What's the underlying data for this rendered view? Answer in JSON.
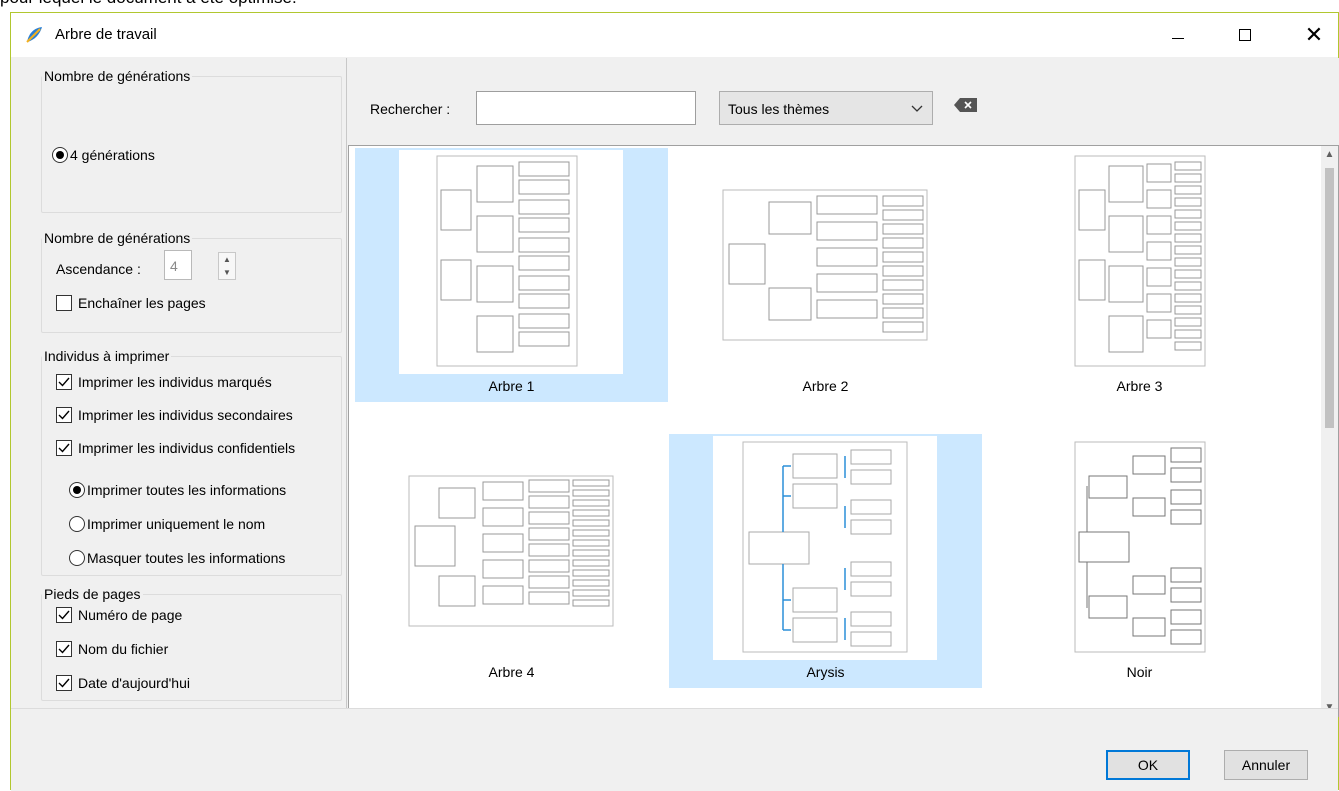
{
  "background_caption": "pour lequel le document a été optimisé.",
  "window": {
    "title": "Arbre de travail",
    "icon": "app-leaf-icon",
    "controls": [
      "minimize-icon",
      "maximize-icon",
      "close-icon"
    ]
  },
  "left": {
    "group1": {
      "legend": "Nombre de générations",
      "radio_label": "4 générations",
      "radio_selected": true
    },
    "group2": {
      "legend": "Nombre de générations",
      "ascendance_label": "Ascendance :",
      "ascendance_value": "4",
      "chain_label": "Enchaîner les pages",
      "chain_checked": false
    },
    "group3": {
      "legend": "Individus à imprimer",
      "checks": [
        {
          "label": "Imprimer les individus marqués",
          "checked": true
        },
        {
          "label": "Imprimer les individus secondaires",
          "checked": true
        },
        {
          "label": "Imprimer les individus confidentiels",
          "checked": true
        }
      ],
      "radios": [
        {
          "label": "Imprimer toutes les informations",
          "selected": true
        },
        {
          "label": "Imprimer uniquement le nom",
          "selected": false
        },
        {
          "label": "Masquer toutes les informations",
          "selected": false
        }
      ]
    },
    "group4": {
      "legend": "Pieds de pages",
      "checks": [
        {
          "label": "Numéro de page",
          "checked": true
        },
        {
          "label": "Nom du fichier",
          "checked": true
        },
        {
          "label": "Date d'aujourd'hui",
          "checked": true
        }
      ]
    }
  },
  "search": {
    "label": "Rechercher :",
    "value": "",
    "placeholder": "",
    "theme_selected": "Tous les thèmes",
    "clear_icon": "clear-search-icon"
  },
  "gallery": {
    "items": [
      {
        "label": "Arbre 1",
        "selected": true,
        "style": "wide-left"
      },
      {
        "label": "Arbre 2",
        "selected": false,
        "style": "landscape"
      },
      {
        "label": "Arbre 3",
        "selected": false,
        "style": "narrow"
      },
      {
        "label": "Arbre 4",
        "selected": false,
        "style": "landscape"
      },
      {
        "label": "Arysis",
        "selected": true,
        "style": "blue"
      },
      {
        "label": "Noir",
        "selected": false,
        "style": "dark"
      }
    ],
    "toolbar_icons": [
      "add-favorite-icon",
      "remove-favorite-icon",
      "add-icon",
      "remove-icon",
      "edit-icon"
    ]
  },
  "buttons": {
    "ok": "OK",
    "cancel": "Annuler"
  },
  "colors": {
    "selection": "#cce8ff",
    "accent": "#0078d7",
    "heart": "#e0383e",
    "window_border": "#b1c72f"
  }
}
